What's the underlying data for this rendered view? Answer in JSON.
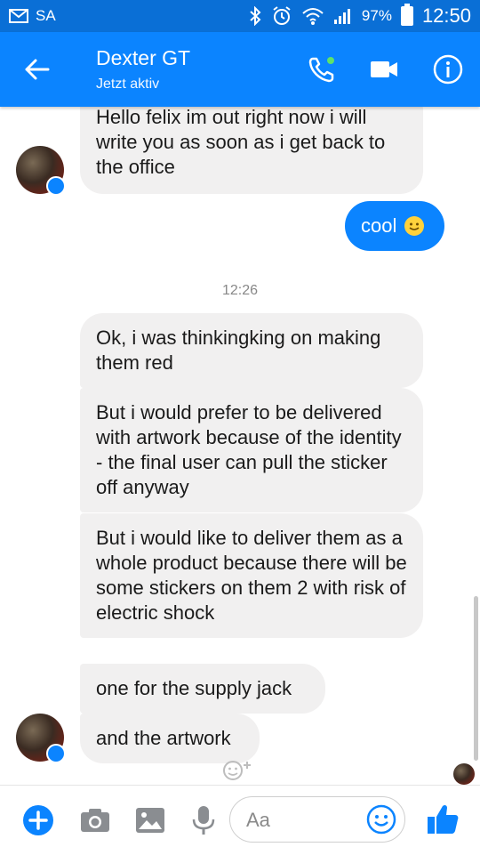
{
  "status_bar": {
    "carrier": "SA",
    "battery": "97%",
    "time": "12:50"
  },
  "header": {
    "contact_name": "Dexter GT",
    "status": "Jetzt aktiv"
  },
  "messages": {
    "m1": "Hello felix im out right now i will write you as soon as i get back to the office",
    "m2": "cool",
    "timestamp": "12:26",
    "m3": "Ok, i was thinkingking on making them red",
    "m4": "But i would prefer to be delivered with artwork because of the identity - the final user can pull the sticker off anyway",
    "m5": "But i would like to deliver them as a whole product because there will be some stickers on them 2 with risk of electric shock",
    "m6": "one for the supply jack",
    "m7": "and the artwork"
  },
  "composer": {
    "placeholder": "Aa"
  },
  "colors": {
    "status_bar": "#0a6fd6",
    "app_bar": "#0b84ff",
    "incoming_bubble": "#f1f0f0",
    "outgoing_bubble": "#0b84ff"
  }
}
